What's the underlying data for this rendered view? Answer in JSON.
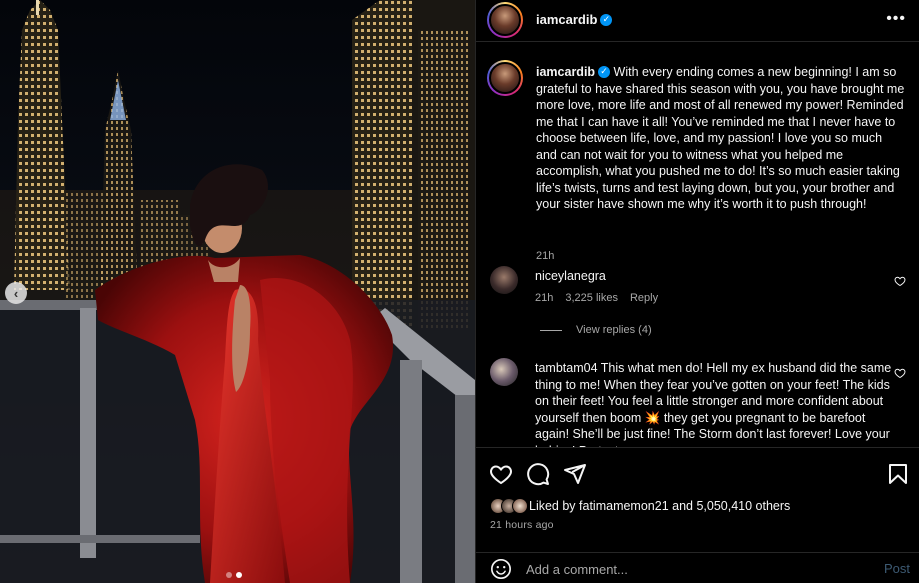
{
  "post": {
    "photo_alt": "",
    "carousel_prev_glyph": "‹"
  },
  "header": {
    "username": "iamcardib",
    "more_glyph": "•••"
  },
  "caption": {
    "username": "iamcardib",
    "text": "With every ending comes a new beginning! I am so grateful to have shared this season with you, you have brought me more love, more life and most of all renewed my power! Reminded me that I can have it all! You’ve reminded me that I never have to choose between life, love, and my passion! I love you so much and can not wait for you to witness what you helped me accomplish, what you pushed me to do! It’s so much easier taking life’s twists, turns and test laying down, but you, your brother and your sister have shown me why it’s worth it to push through!",
    "time": "21h"
  },
  "comments": [
    {
      "username": "niceylanegra",
      "text": "",
      "time": "21h",
      "likes": "3,225 likes",
      "reply_label": "Reply",
      "view_replies": "View replies (4)"
    },
    {
      "username": "tambtam04",
      "text": "This what men do! Hell my ex husband did the same thing to me! When they fear you’ve gotten on your feet! The kids on their feet! You feel a little stronger and more confident about yourself then boom 💥 they get you pregnant to be barefoot again! She’ll be just fine! The Storm don’t last forever! Love your babies! Protect your"
    }
  ],
  "likes": {
    "prefix": "Liked by ",
    "user": "fatimamemon21",
    "middle": " and ",
    "count": "5,050,410 others"
  },
  "post_time": "21 hours ago",
  "add_comment": {
    "placeholder": "Add a comment...",
    "post_label": "Post"
  }
}
